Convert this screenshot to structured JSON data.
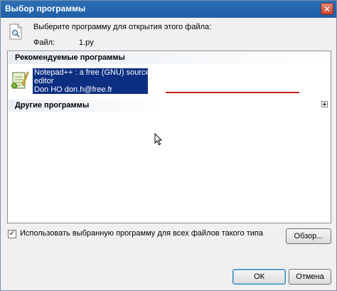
{
  "window": {
    "title": "Выбор программы",
    "close_label": "✕"
  },
  "header": {
    "prompt": "Выберите программу для открытия этого файла:",
    "file_label": "Файл:",
    "file_name": "1.py"
  },
  "program_list": {
    "recommended_header": "Рекомендуемые программы",
    "other_header": "Другие программы",
    "items": [
      {
        "line1": "Notepad++ : a free (GNU) source code",
        "line2": "editor",
        "line3": "Don HO don.h@free.fr",
        "icon": "notepad-plus-plus-icon",
        "selected": true
      }
    ],
    "expand_icon": "plus-expand-icon"
  },
  "options": {
    "always_use_checked": true,
    "check_mark": "✓",
    "always_use_label": "Использовать выбранную программу для всех файлов такого типа",
    "browse_label": "Обзор..."
  },
  "footer": {
    "ok_label": "ОК",
    "cancel_label": "Отмена"
  },
  "colors": {
    "titlebar": "#1d5ea7",
    "selection": "#0c2f82",
    "annotation_line": "#cc2222"
  }
}
